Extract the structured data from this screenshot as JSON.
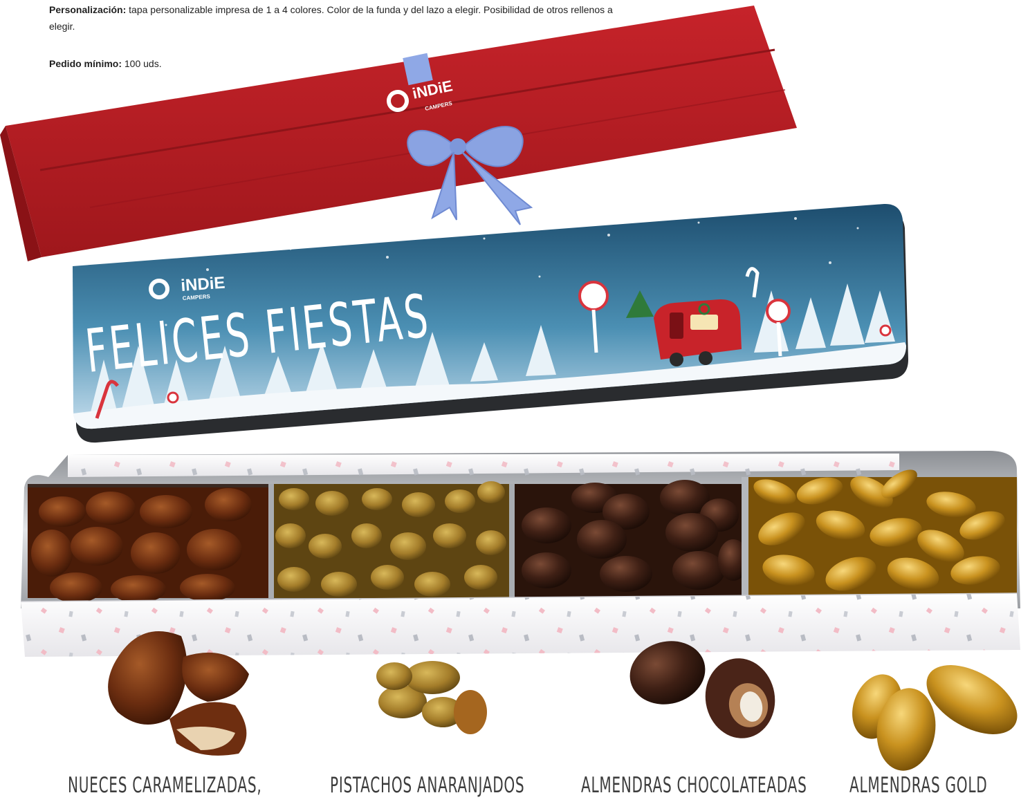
{
  "info": {
    "personalization_label": "Personalización:",
    "personalization_text": " tapa personalizable impresa de 1 a 4 colores. Color de la funda y del lazo a elegir. Posibilidad de otros rellenos a elegir.",
    "min_order_label": "Pedido mínimo:",
    "min_order_text": " 100 uds."
  },
  "brand": {
    "name": "iNDiE",
    "sub": "CAMPERS"
  },
  "lid": {
    "greeting": "FELICES FIESTAS"
  },
  "products": [
    {
      "label": "NUECES CARAMELIZADAS,"
    },
    {
      "label": "PISTACHOS ANARANJADOS"
    },
    {
      "label": "ALMENDRAS CHOCOLATEADAS"
    },
    {
      "label": "ALMENDRAS GOLD"
    }
  ],
  "colors": {
    "sleeve_red": "#b81e24",
    "ribbon_blue": "#8fa8e6",
    "lid_sky": "#2f6d8f",
    "tin_silver": "#cfd1d4",
    "liner_white": "#f3f2f4"
  }
}
